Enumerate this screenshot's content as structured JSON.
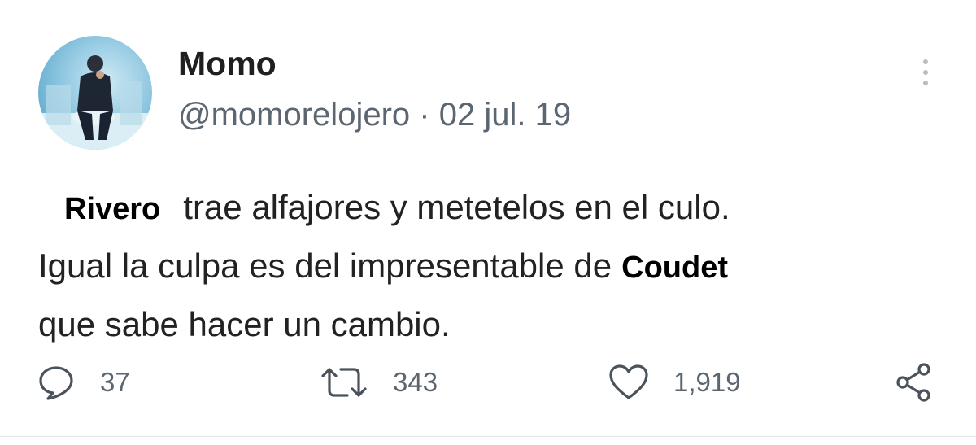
{
  "tweet": {
    "display_name": "Momo",
    "handle": "@momorelojero",
    "separator": "·",
    "date": "02 jul. 19",
    "body": {
      "redacted_name_1": "Rivero",
      "line1_rest": "trae alfajores y metetelos en el culo.",
      "line2_start": "Igual la culpa es del impresentable de",
      "redacted_name_2": "Coudet",
      "line3": "que sabe hacer un cambio."
    }
  },
  "actions": {
    "reply_icon": "reply-icon",
    "reply_count": "37",
    "retweet_icon": "retweet-icon",
    "retweet_count": "343",
    "like_icon": "heart-icon",
    "like_count": "1,919",
    "share_icon": "share-icon"
  },
  "colors": {
    "text": "#222222",
    "muted": "#5c6670",
    "avatar_bg": "#6fb4d3"
  }
}
